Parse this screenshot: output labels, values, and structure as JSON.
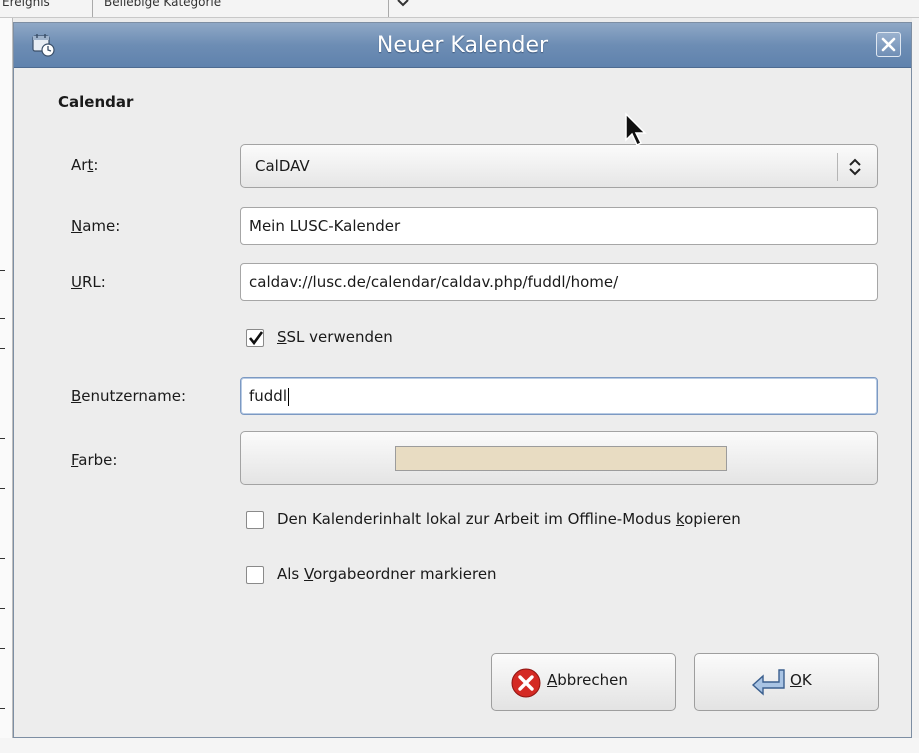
{
  "background": {
    "header_left": "Ereignis",
    "header_right": "Beliebige Kategorie",
    "header_dropdown_icon": "chevron-down-icon"
  },
  "dialog": {
    "title": "Neuer Kalender",
    "title_icon": "calendar-icon",
    "close_icon": "close-icon",
    "section_title": "Calendar",
    "type": {
      "label_parts": [
        "Ar",
        "t",
        ":"
      ],
      "value": "CalDAV",
      "icon": "updown-arrows-icon"
    },
    "name": {
      "label_parts": [
        "",
        "N",
        "ame:"
      ],
      "value": "Mein LUSC-Kalender"
    },
    "url": {
      "label_parts": [
        "",
        "U",
        "RL:"
      ],
      "value": "caldav://lusc.de/calendar/caldav.php/fuddl/home/"
    },
    "ssl": {
      "label_parts": [
        "",
        "S",
        "SL verwenden"
      ],
      "checked": true
    },
    "username": {
      "label_parts": [
        "",
        "B",
        "enutzername:"
      ],
      "value": "fuddl"
    },
    "color": {
      "label_parts": [
        "",
        "F",
        "arbe:"
      ],
      "value": "#e8dcc2"
    },
    "offline": {
      "label_parts": [
        "Den Kalenderinhalt lokal zur Arbeit im Offline-Modus ",
        "k",
        "opieren"
      ],
      "checked": false
    },
    "default_folder": {
      "label_parts": [
        "Als ",
        "V",
        "orgabeordner markieren"
      ],
      "checked": false
    },
    "cancel": {
      "label_parts": [
        "",
        "A",
        "bbrechen"
      ],
      "icon": "cancel-icon"
    },
    "ok": {
      "label_parts": [
        "",
        "O",
        "K"
      ],
      "icon": "enter-arrow-icon"
    }
  }
}
